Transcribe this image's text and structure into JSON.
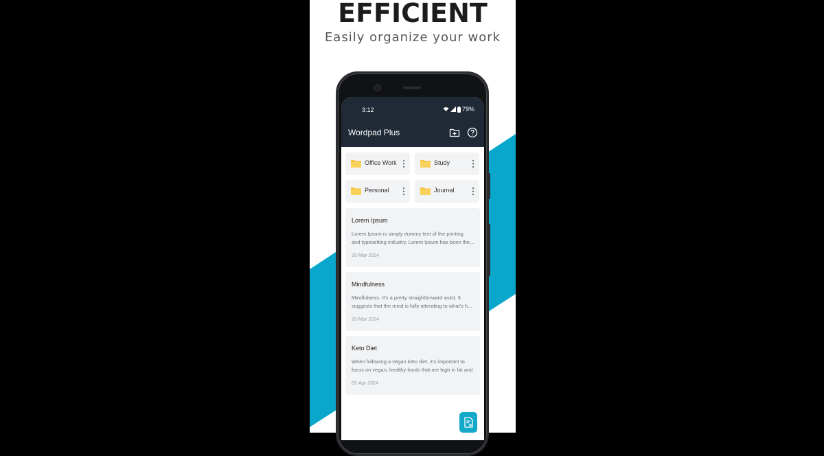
{
  "promo": {
    "title": "EFFICIENT",
    "subtitle": "Easily organize your work",
    "accent_color": "#0aa7cc"
  },
  "status_bar": {
    "time": "3:12",
    "battery": "79%",
    "icons": [
      "wifi-icon",
      "signal-icon",
      "battery-icon"
    ]
  },
  "app_bar": {
    "title": "Wordpad Plus",
    "actions": [
      "add-folder-icon",
      "help-icon"
    ],
    "background": "#1f2a36"
  },
  "folders": [
    {
      "label": "Office Work"
    },
    {
      "label": "Study"
    },
    {
      "label": "Personal"
    },
    {
      "label": "Journal"
    }
  ],
  "notes": [
    {
      "title": "Lorem Ipsum",
      "line1": "Lorem Ipsum is simply dummy text of the printing",
      "line2": "and typesetting industry. Lorem Ipsum has been the...",
      "date": "20-Mar-2024"
    },
    {
      "title": "Mindfulness",
      "line1": "Mindfulness. It's a pretty straightforward word. It",
      "line2": "suggests that the mind is fully attending to what's h...",
      "date": "20-Mar-2024"
    },
    {
      "title": "Keto Diet",
      "line1": "When following a vegan keto diet, it's important to",
      "line2": "focus on vegan, healthy foods that are high in fat and",
      "date": "05-Apr-2024"
    }
  ],
  "fab": {
    "icon": "new-note-icon",
    "color": "#14a8c9"
  }
}
